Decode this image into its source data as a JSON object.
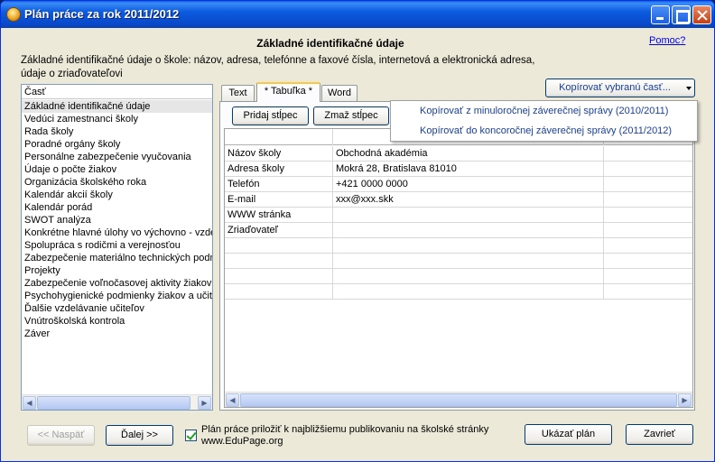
{
  "window": {
    "title": "Plán práce za rok 2011/2012"
  },
  "header": {
    "title": "Základné identifikačné údaje",
    "help": "Pomoc?",
    "description_line1": "Základné identifikačné údaje o škole: názov, adresa, telefónne a faxové čísla, internetová a elektronická adresa,",
    "description_line2": "údaje o zriaďovateľovi"
  },
  "sections": {
    "header": "Časť",
    "items": [
      "Základné identifikačné údaje",
      "Vedúci zamestnanci školy",
      "Rada školy",
      "Poradné orgány školy",
      "Personálne zabezpečenie vyučovania",
      "Údaje o počte žiakov",
      "Organizácia školského roka",
      "Kalendár akcií školy",
      "Kalendár porád",
      "SWOT analýza",
      "Konkrétne hlavné úlohy vo výchovno - vzdelávacom procese",
      "Spolupráca s rodičmi a verejnosťou",
      "Zabezpečenie materiálno technických podmienok",
      "Projekty",
      "Zabezpečenie voľnočasovej aktivity žiakov",
      "Psychohygienické podmienky žiakov a učiteľov",
      "Ďalšie vzdelávanie učiteľov",
      "Vnútroškolská kontrola",
      "Záver"
    ],
    "selected": 0
  },
  "tabs": [
    {
      "label": "Text"
    },
    {
      "label": "* Tabuľka *"
    },
    {
      "label": "Word"
    }
  ],
  "toolbar": {
    "add_column": "Pridaj stĺpec",
    "remove_column": "Zmaž stĺpec",
    "copy_part": "Kopírovať vybranú časť..."
  },
  "copy_menu": {
    "items": [
      "Kopírovať z minuloročnej záverečnej správy (2010/2011)",
      "Kopírovať do koncoročnej záverečnej správy (2011/2012)"
    ]
  },
  "table": {
    "rows": [
      {
        "label": "Názov školy",
        "value": "Obchodná akadémia"
      },
      {
        "label": "Adresa školy",
        "value": "Mokrá 28, Bratislava 81010"
      },
      {
        "label": "Telefón",
        "value": "+421 0000 0000"
      },
      {
        "label": "E-mail",
        "value": "xxx@xxx.skk"
      },
      {
        "label": "WWW stránka",
        "value": ""
      },
      {
        "label": "Zriaďovateľ",
        "value": ""
      },
      {
        "label": "",
        "value": ""
      },
      {
        "label": "",
        "value": ""
      },
      {
        "label": "",
        "value": ""
      },
      {
        "label": "",
        "value": ""
      }
    ]
  },
  "footer": {
    "back": "<< Naspäť",
    "next": "Ďalej >>",
    "publish_line1": "Plán práce priložiť k najbližšiemu publikovaniu na školské stránky",
    "publish_line2": "www.EduPage.org",
    "show_plan": "Ukázať plán",
    "close": "Zavrieť"
  }
}
